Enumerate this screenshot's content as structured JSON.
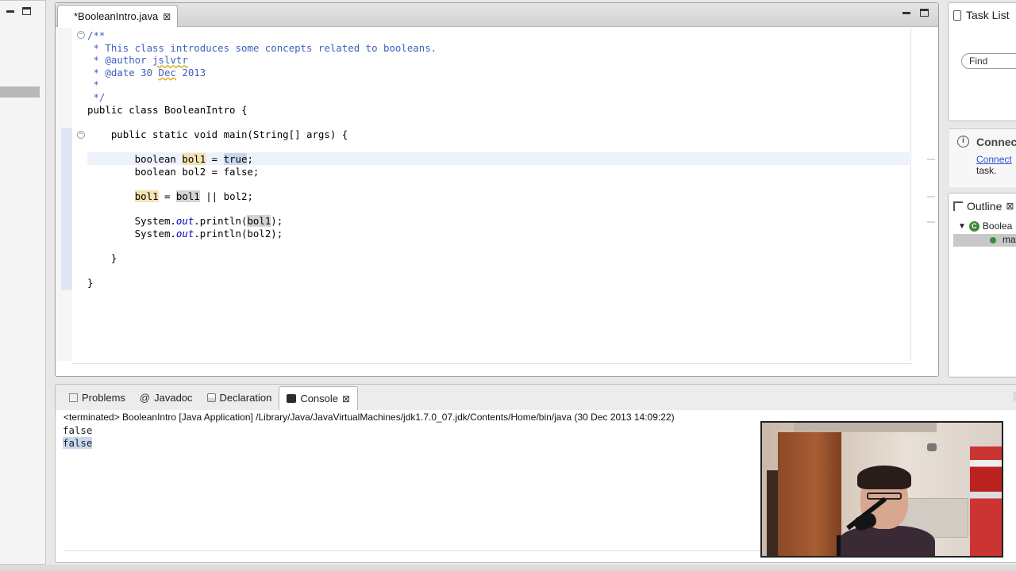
{
  "editor": {
    "tab_title": "*BooleanIntro.java",
    "code_lines": [
      {
        "segments": [
          {
            "t": "/**",
            "c": "cm"
          }
        ]
      },
      {
        "segments": [
          {
            "t": " * This class introduces some concepts related to booleans.",
            "c": "cm"
          }
        ]
      },
      {
        "segments": [
          {
            "t": " * @author ",
            "c": "cm"
          },
          {
            "t": "jslvtr",
            "c": "cm squig"
          }
        ]
      },
      {
        "segments": [
          {
            "t": " * @date 30 ",
            "c": "cm"
          },
          {
            "t": "Dec",
            "c": "cm squig"
          },
          {
            "t": " 2013",
            "c": "cm"
          }
        ]
      },
      {
        "segments": [
          {
            "t": " *",
            "c": "cm"
          }
        ]
      },
      {
        "segments": [
          {
            "t": " */",
            "c": "cm"
          }
        ]
      },
      {
        "segments": [
          {
            "t": "public class BooleanIntro {",
            "c": ""
          }
        ]
      },
      {
        "segments": [
          {
            "t": "",
            "c": ""
          }
        ]
      },
      {
        "segments": [
          {
            "t": "    public static void main(String[] args) {",
            "c": ""
          }
        ]
      },
      {
        "segments": [
          {
            "t": "",
            "c": ""
          }
        ]
      },
      {
        "segments": [
          {
            "t": "        boolean ",
            "c": ""
          },
          {
            "t": "bol1",
            "c": "occ"
          },
          {
            "t": " = ",
            "c": ""
          },
          {
            "t": "true",
            "c": "selw"
          },
          {
            "t": ";",
            "c": ""
          }
        ]
      },
      {
        "segments": [
          {
            "t": "        boolean bol2 = false;",
            "c": ""
          }
        ]
      },
      {
        "segments": [
          {
            "t": "",
            "c": ""
          }
        ]
      },
      {
        "segments": [
          {
            "t": "        ",
            "c": ""
          },
          {
            "t": "bol1",
            "c": "occ"
          },
          {
            "t": " = ",
            "c": ""
          },
          {
            "t": "bol1",
            "c": "occ2"
          },
          {
            "t": " || bol2;",
            "c": ""
          }
        ]
      },
      {
        "segments": [
          {
            "t": "",
            "c": ""
          }
        ]
      },
      {
        "segments": [
          {
            "t": "        System.",
            "c": ""
          },
          {
            "t": "out",
            "c": "it"
          },
          {
            "t": ".println(",
            "c": ""
          },
          {
            "t": "bol1",
            "c": "occ2"
          },
          {
            "t": ");",
            "c": ""
          }
        ]
      },
      {
        "segments": [
          {
            "t": "        System.",
            "c": ""
          },
          {
            "t": "out",
            "c": "it"
          },
          {
            "t": ".println(bol2);",
            "c": ""
          }
        ]
      },
      {
        "segments": [
          {
            "t": "",
            "c": ""
          }
        ]
      },
      {
        "segments": [
          {
            "t": "    }",
            "c": ""
          }
        ]
      },
      {
        "segments": [
          {
            "t": "",
            "c": ""
          }
        ]
      },
      {
        "segments": [
          {
            "t": "}",
            "c": ""
          }
        ]
      }
    ]
  },
  "task_list": {
    "title": "Task List",
    "find_placeholder": "Find"
  },
  "connect": {
    "title": "Connec",
    "link": "Connect",
    "suffix": "task."
  },
  "outline": {
    "title": "Outline",
    "class_item": "Boolea",
    "method_item": "ma"
  },
  "bottom": {
    "tabs": [
      {
        "label": "Problems",
        "icon": "problems-icon"
      },
      {
        "label": "Javadoc",
        "icon": "at-icon"
      },
      {
        "label": "Declaration",
        "icon": "declaration-icon"
      },
      {
        "label": "Console",
        "icon": "console-icon"
      }
    ],
    "console_header": "<terminated> BooleanIntro [Java Application] /Library/Java/JavaVirtualMachines/jdk1.7.0_07.jdk/Contents/Home/bin/java (30 Dec 2013 14:09:22)",
    "output": [
      "false",
      "false"
    ]
  }
}
